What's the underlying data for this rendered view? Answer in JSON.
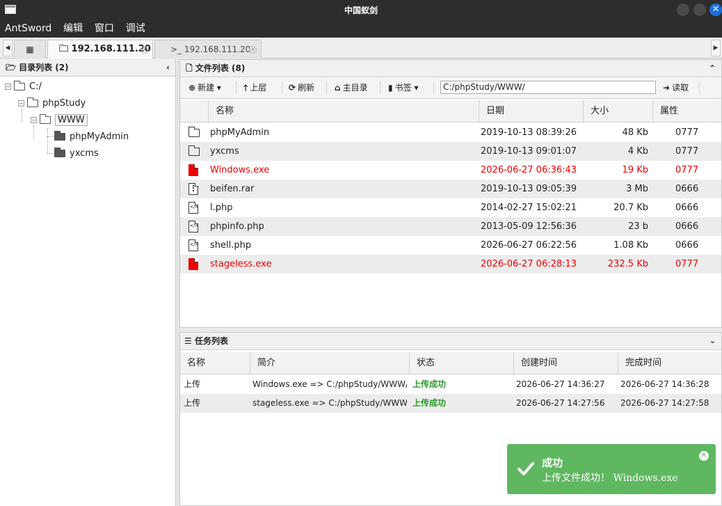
{
  "window": {
    "title": "中国蚁剑"
  },
  "menu": [
    "AntSword",
    "编辑",
    "窗口",
    "调试"
  ],
  "tabs": [
    {
      "label": "192.168.111.20",
      "icon": "folder-icon"
    },
    {
      "label": "192.168.111.20",
      "icon": "terminal-icon"
    }
  ],
  "dir_panel": {
    "title": "目录列表 (2)",
    "tree": {
      "root": "C:/",
      "l1": "phpStudy",
      "l2": "WWW",
      "children": [
        "phpMyAdmin",
        "yxcms"
      ]
    }
  },
  "file_panel": {
    "title": "文件列表 (8)",
    "toolbar": {
      "new": "新建",
      "up": "上层",
      "refresh": "刷新",
      "home": "主目录",
      "bookmark": "书签",
      "read": "读取"
    },
    "path": "C:/phpStudy/WWW/",
    "columns": [
      "名称",
      "日期",
      "大小",
      "属性"
    ],
    "files": [
      {
        "name": "phpMyAdmin",
        "date": "2019-10-13 08:39:26",
        "size": "48 Kb",
        "attr": "0777",
        "type": "folder"
      },
      {
        "name": "yxcms",
        "date": "2019-10-13 09:01:07",
        "size": "4 Kb",
        "attr": "0777",
        "type": "folder"
      },
      {
        "name": "Windows.exe",
        "date": "2026-06-27 06:36:43",
        "size": "19 Kb",
        "attr": "0777",
        "type": "exe"
      },
      {
        "name": "beifen.rar",
        "date": "2019-10-13 09:05:39",
        "size": "3 Mb",
        "attr": "0666",
        "type": "zip"
      },
      {
        "name": "l.php",
        "date": "2014-02-27 15:02:21",
        "size": "20.7 Kb",
        "attr": "0666",
        "type": "code"
      },
      {
        "name": "phpinfo.php",
        "date": "2013-05-09 12:56:36",
        "size": "23 b",
        "attr": "0666",
        "type": "code"
      },
      {
        "name": "shell.php",
        "date": "2026-06-27 06:22:56",
        "size": "1.08 Kb",
        "attr": "0666",
        "type": "code"
      },
      {
        "name": "stageless.exe",
        "date": "2026-06-27 06:28:13",
        "size": "232.5 Kb",
        "attr": "0777",
        "type": "exe"
      }
    ]
  },
  "task_panel": {
    "title": "任务列表",
    "columns": [
      "名称",
      "简介",
      "状态",
      "创建时间",
      "完成时间"
    ],
    "tasks": [
      {
        "name": "上传",
        "desc": "Windows.exe => C:/phpStudy/WWW/",
        "status": "上传成功",
        "created": "2026-06-27 14:36:27",
        "finished": "2026-06-27 14:36:28"
      },
      {
        "name": "上传",
        "desc": "stageless.exe => C:/phpStudy/WWW/",
        "status": "上传成功",
        "created": "2026-06-27 14:27:56",
        "finished": "2026-06-27 14:27:58"
      }
    ]
  },
  "toast": {
    "title": "成功",
    "message": "上传文件成功！ Windows.exe"
  },
  "colors": {
    "danger": "#ee0000",
    "success": "#2a9a2a",
    "toast_bg": "#5fb760",
    "titlebar": "#2d2d2d",
    "close_btn": "#1c6fd9"
  }
}
